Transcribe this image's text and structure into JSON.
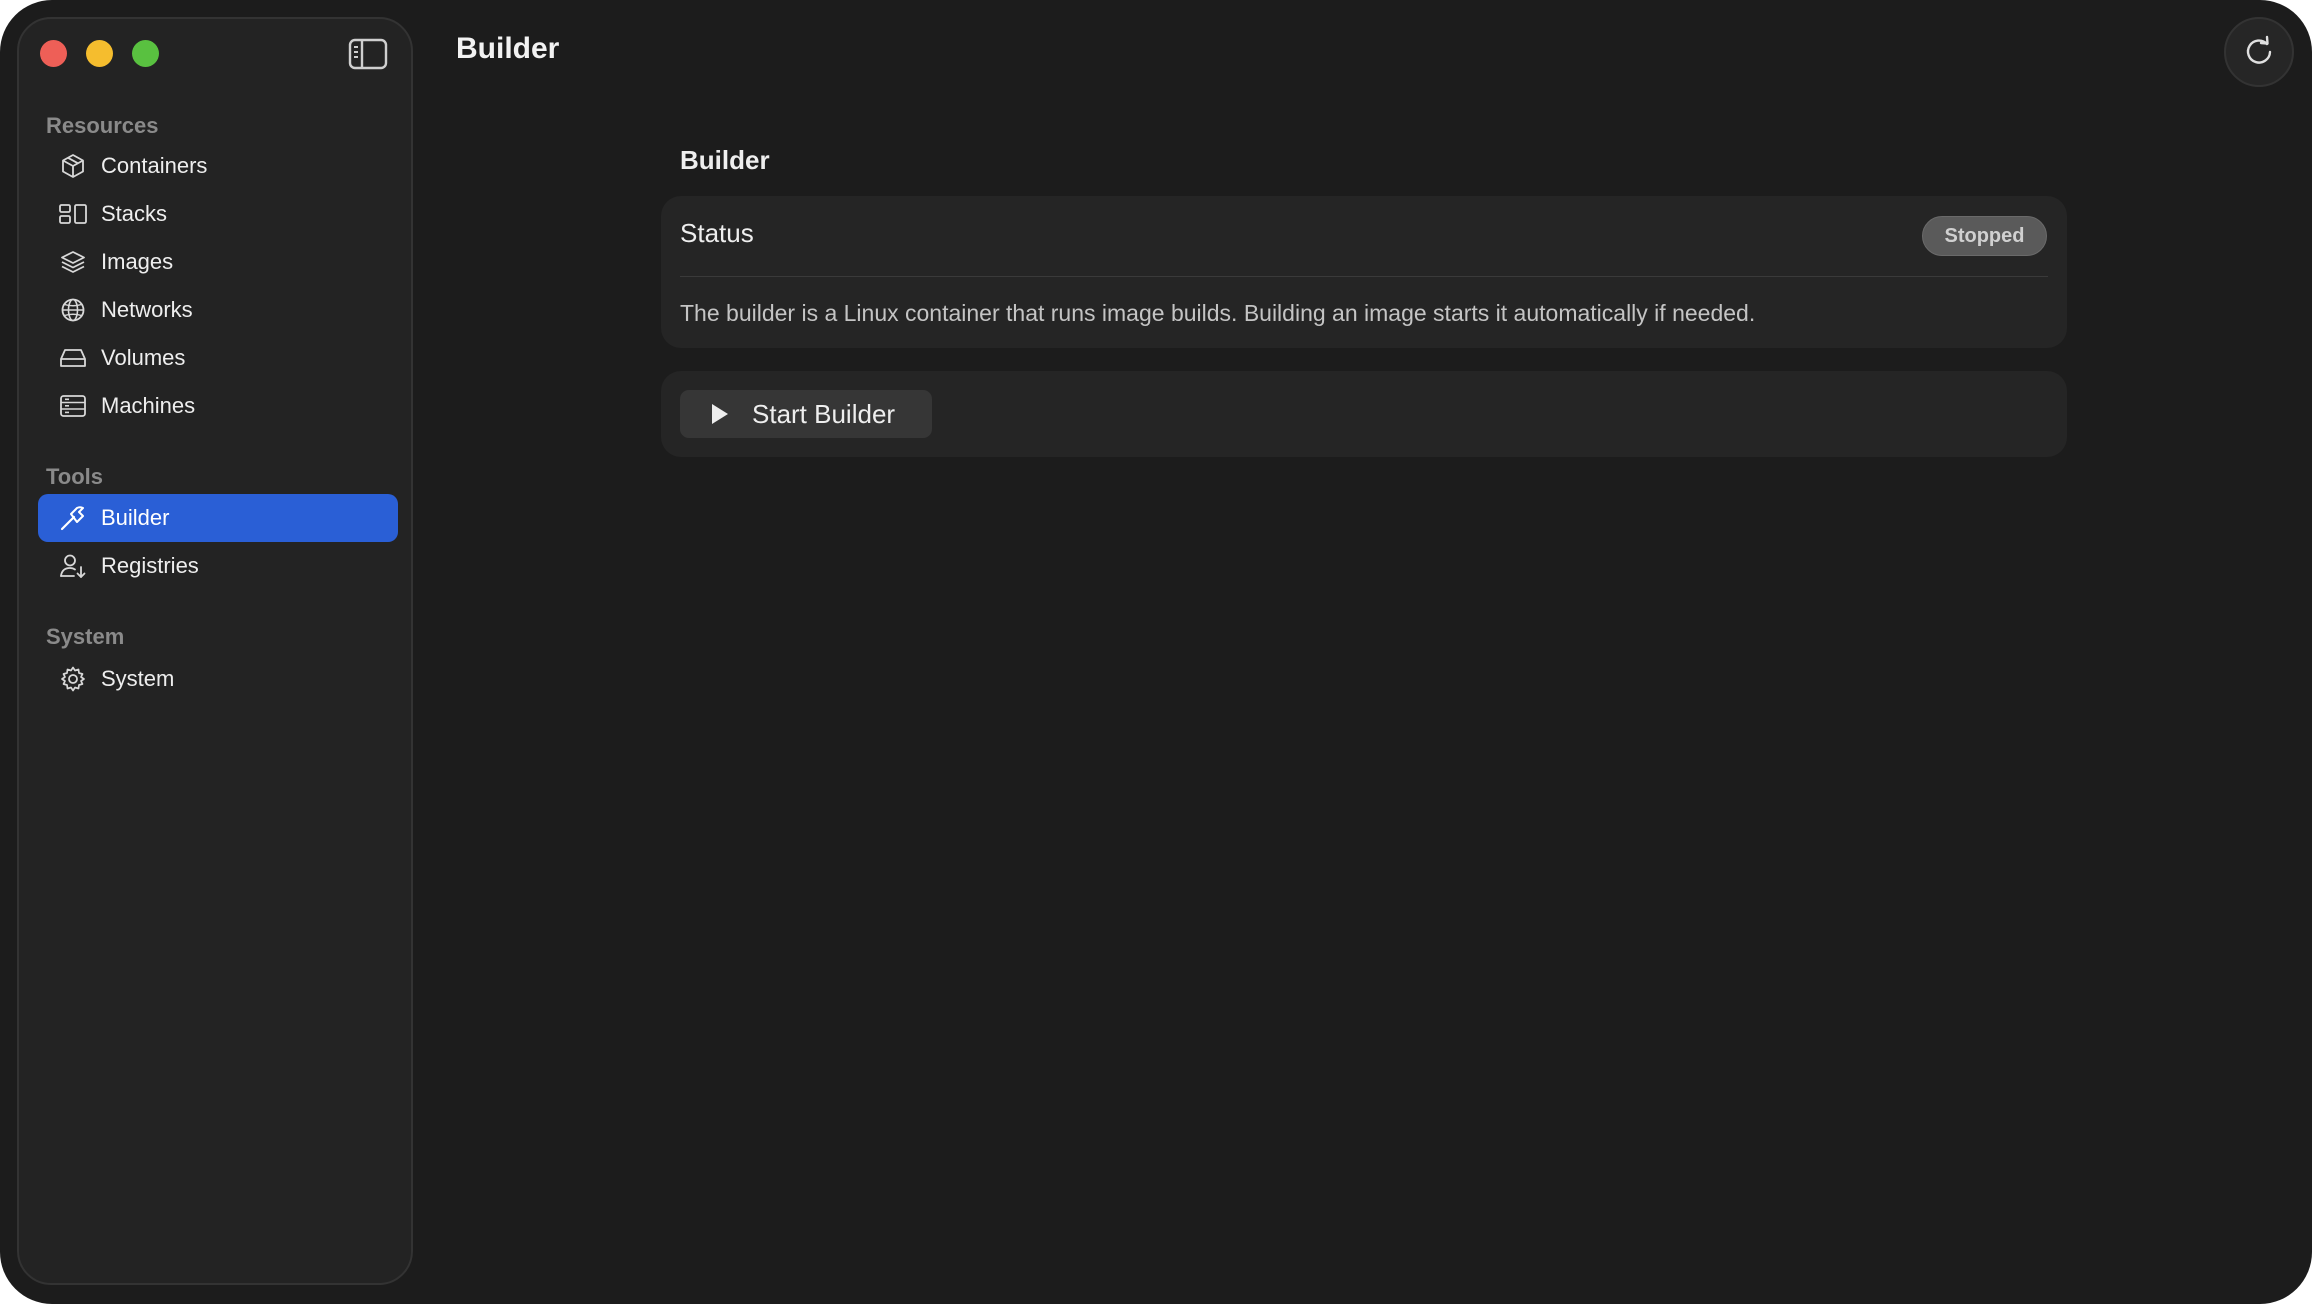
{
  "window": {
    "title": "Builder",
    "controls": [
      "close",
      "minimize",
      "zoom"
    ]
  },
  "sidebar": {
    "toggle_icon": "sidebar-toggle-icon",
    "sections": [
      {
        "label": "Resources",
        "items": [
          {
            "label": "Containers",
            "icon": "cube-icon"
          },
          {
            "label": "Stacks",
            "icon": "stack-icon"
          },
          {
            "label": "Images",
            "icon": "layers-icon"
          },
          {
            "label": "Networks",
            "icon": "globe-icon"
          },
          {
            "label": "Volumes",
            "icon": "drive-icon"
          },
          {
            "label": "Machines",
            "icon": "server-icon"
          }
        ]
      },
      {
        "label": "Tools",
        "items": [
          {
            "label": "Builder",
            "icon": "hammer-icon",
            "active": true
          },
          {
            "label": "Registries",
            "icon": "person-download-icon"
          }
        ]
      },
      {
        "label": "System",
        "items": [
          {
            "label": "System",
            "icon": "gear-icon"
          }
        ]
      }
    ]
  },
  "header": {
    "title": "Builder",
    "refresh_icon": "refresh-icon"
  },
  "main": {
    "section_heading": "Builder",
    "status": {
      "label": "Status",
      "badge": "Stopped",
      "description": "The builder is a Linux container that runs image builds. Building an image starts it automatically if needed."
    },
    "actions": {
      "start_label": "Start Builder",
      "start_icon": "play-icon"
    }
  },
  "colors": {
    "accent": "#2a5fd6",
    "window_bg": "#1c1c1c",
    "sidebar_bg": "#232323",
    "card_bg": "#252525",
    "badge_bg": "#5a5a5a"
  }
}
